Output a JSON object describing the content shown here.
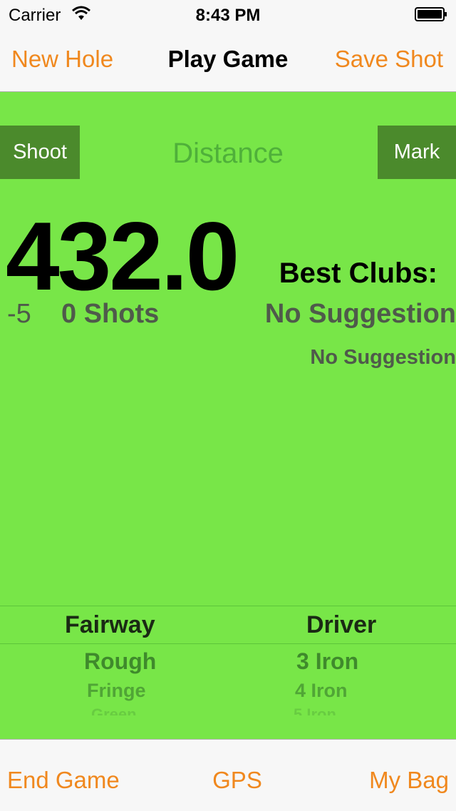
{
  "status_bar": {
    "carrier": "Carrier",
    "time": "8:43 PM",
    "icons": [
      "wifi-icon",
      "battery-icon"
    ]
  },
  "nav": {
    "left": "New Hole",
    "title": "Play Game",
    "right": "Save Shot"
  },
  "main": {
    "shoot_label": "Shoot",
    "distance_label": "Distance",
    "mark_label": "Mark",
    "distance_value": "432.0",
    "best_clubs_label": "Best Clubs:",
    "par_diff": "-5",
    "shots_count": "0 Shots",
    "suggestion_primary": "No Suggestion",
    "suggestion_secondary": "No Suggestion"
  },
  "pickers": {
    "lie": {
      "selected": "Fairway",
      "options": [
        "Rough",
        "Fringe",
        "Green"
      ]
    },
    "club": {
      "selected": "Driver",
      "options": [
        "3 Iron",
        "4 Iron",
        "5 Iron"
      ]
    }
  },
  "tabbar": {
    "end_game": "End Game",
    "gps": "GPS",
    "my_bag": "My Bag"
  },
  "colors": {
    "accent": "#f0881e",
    "background": "#78e648",
    "button": "#4b8a2c"
  }
}
